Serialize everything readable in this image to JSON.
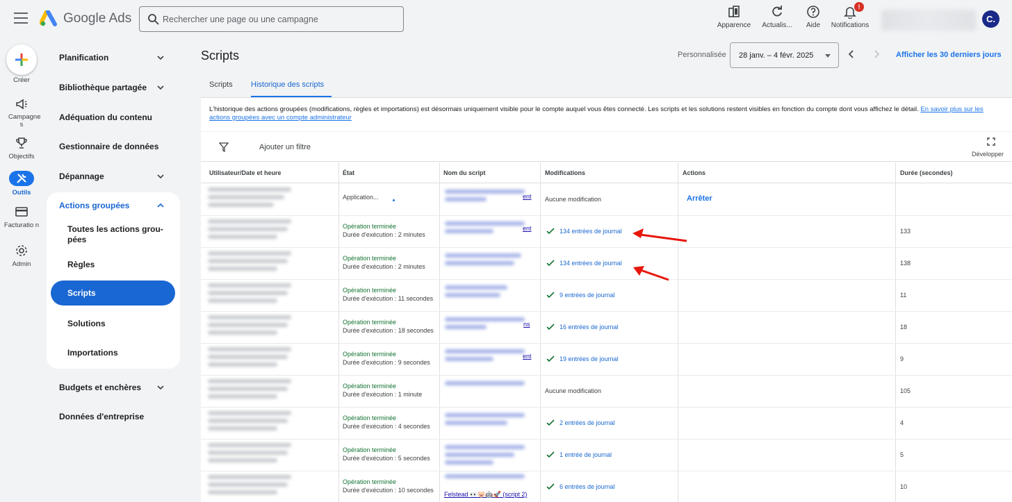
{
  "app": {
    "brand": "Google Ads",
    "search_placeholder": "Rechercher une page ou une campagne",
    "toolbar": {
      "appearance": "Apparence",
      "refresh": "Actualis...",
      "help": "Aide",
      "notifications": "Notifications",
      "notifications_badge": "!"
    },
    "avatar_initial": "C."
  },
  "rail": {
    "create": "Créer",
    "campaigns": "Campagne s",
    "objectives": "Objectifs",
    "tools": "Outils",
    "billing": "Facturatio n",
    "admin": "Admin"
  },
  "nav": {
    "planning": "Planification",
    "shared_library": "Bibliothèque partagée",
    "content_suitability": "Adéquation du contenu",
    "data_manager": "Gestionnaire de données",
    "troubleshooting": "Dépannage",
    "bulk_actions": "Actions groupées",
    "bulk_sub": {
      "all": "Toutes les actions grou- pées",
      "rules": "Règles",
      "scripts": "Scripts",
      "solutions": "Solutions",
      "imports": "Importations"
    },
    "budgets_bids": "Budgets et enchères",
    "business_data": "Données d'entreprise"
  },
  "main": {
    "title": "Scripts",
    "date_label": "Personnalisée",
    "date_range": "28 janv. – 4 févr. 2025",
    "last_30": "Afficher les 30 derniers jours",
    "tabs": [
      "Scripts",
      "Historique des scripts"
    ],
    "info_text": "L'historique des actions groupées (modifications, règles et importations) est désormais uniquement visible pour le compte auquel vous êtes connecté. Les scripts et les solutions restent visibles en fonction du compte dont vous affichez le détail.",
    "info_link": "En savoir plus sur les actions groupées avec un compte administrateur",
    "add_filter": "Ajouter un filtre",
    "expand": "Développer"
  },
  "table": {
    "headers": {
      "user": "Utilisateur/Date et heure",
      "state": "État",
      "script": "Nom du script",
      "mods": "Modifications",
      "actions": "Actions",
      "duration": "Durée (secondes)"
    },
    "rows": [
      {
        "state1": "Application...",
        "mods": "Aucune modification",
        "action": "Arrêter",
        "duration": "",
        "suffix": "ent"
      },
      {
        "state1": "Opération terminée",
        "state2": "Durée d'exécution : 2 minutes",
        "mods": "134 entrées de journal",
        "duration": "133",
        "suffix": "ent"
      },
      {
        "state1": "Opération terminée",
        "state2": "Durée d'exécution : 2 minutes",
        "mods": "134 entrées de journal",
        "duration": "138",
        "suffix": ""
      },
      {
        "state1": "Opération terminée",
        "state2": "Durée d'exécution : 11 secondes",
        "mods": "9 entrées de journal",
        "duration": "11",
        "suffix": ""
      },
      {
        "state1": "Opération terminée",
        "state2": "Durée d'exécution : 18 secondes",
        "mods": "16 entrées de journal",
        "duration": "18",
        "suffix": "ns"
      },
      {
        "state1": "Opération terminée",
        "state2": "Durée d'exécution : 9 secondes",
        "mods": "19 entrées de journal",
        "duration": "9",
        "suffix": "ent"
      },
      {
        "state1": "Opération terminée",
        "state2": "Durée d'exécution : 1 minute",
        "mods": "Aucune modification",
        "duration": "105",
        "suffix": ""
      },
      {
        "state1": "Opération terminée",
        "state2": "Durée d'exécution : 4 secondes",
        "mods": "2 entrées de journal",
        "duration": "4",
        "suffix": ""
      },
      {
        "state1": "Opération terminée",
        "state2": "Durée d'exécution : 5 secondes",
        "mods": "1 entrée de journal",
        "duration": "5",
        "suffix": ""
      },
      {
        "state1": "Opération terminée",
        "state2": "Durée d'exécution : 10 secondes",
        "mods": "6 entrées de journal",
        "duration": "10",
        "script_name": "Felstead 👀🐷🤖🚀 (script 2)"
      }
    ]
  },
  "colors": {
    "accent": "#1a73e8",
    "success": "#137333",
    "annotation": "#e8160c"
  }
}
